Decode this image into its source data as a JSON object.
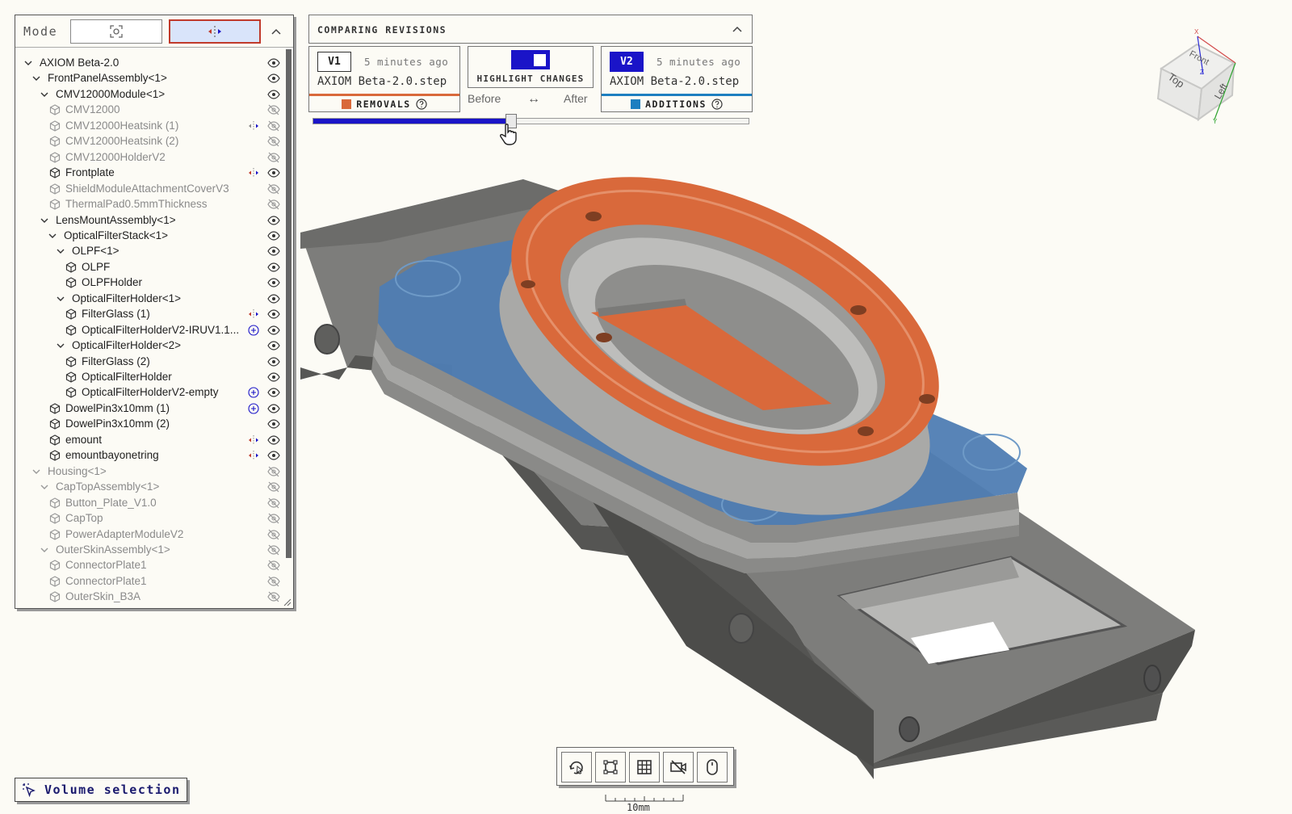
{
  "colors": {
    "accent": "#1a14c8",
    "removal": "#d9693b",
    "addition": "#1d7fc0",
    "active_border": "#c03a2b"
  },
  "mode_bar": {
    "label": "Mode",
    "buttons": [
      {
        "icon": "focus-select-icon",
        "active": false
      },
      {
        "icon": "explode-arrows-icon",
        "active": true
      }
    ],
    "collapse_icon": "chevron-up-icon"
  },
  "tree": {
    "items": [
      {
        "label": "AXIOM Beta-2.0",
        "depth": 0,
        "type": "assembly",
        "visible": true,
        "dim": false,
        "action": ""
      },
      {
        "label": "FrontPanelAssembly<1>",
        "depth": 1,
        "type": "assembly",
        "visible": true,
        "dim": false,
        "action": ""
      },
      {
        "label": "CMV12000Module<1>",
        "depth": 2,
        "type": "assembly",
        "visible": true,
        "dim": false,
        "action": ""
      },
      {
        "label": "CMV12000",
        "depth": 3,
        "type": "part",
        "visible": false,
        "dim": true,
        "action": ""
      },
      {
        "label": "CMV12000Heatsink (1)",
        "depth": 3,
        "type": "part",
        "visible": false,
        "dim": true,
        "action": "changed"
      },
      {
        "label": "CMV12000Heatsink (2)",
        "depth": 3,
        "type": "part",
        "visible": false,
        "dim": true,
        "action": ""
      },
      {
        "label": "CMV12000HolderV2",
        "depth": 3,
        "type": "part",
        "visible": false,
        "dim": true,
        "action": ""
      },
      {
        "label": "Frontplate",
        "depth": 3,
        "type": "part",
        "visible": true,
        "dim": false,
        "action": "changed-red"
      },
      {
        "label": "ShieldModuleAttachmentCoverV3",
        "depth": 3,
        "type": "part",
        "visible": false,
        "dim": true,
        "action": ""
      },
      {
        "label": "ThermalPad0.5mmThickness",
        "depth": 3,
        "type": "part",
        "visible": false,
        "dim": true,
        "action": ""
      },
      {
        "label": "LensMountAssembly<1>",
        "depth": 2,
        "type": "assembly",
        "visible": true,
        "dim": false,
        "action": ""
      },
      {
        "label": "OpticalFilterStack<1>",
        "depth": 3,
        "type": "assembly",
        "visible": true,
        "dim": false,
        "action": ""
      },
      {
        "label": "OLPF<1>",
        "depth": 4,
        "type": "assembly",
        "visible": true,
        "dim": false,
        "action": ""
      },
      {
        "label": "OLPF",
        "depth": 5,
        "type": "part",
        "visible": true,
        "dim": false,
        "action": ""
      },
      {
        "label": "OLPFHolder",
        "depth": 5,
        "type": "part",
        "visible": true,
        "dim": false,
        "action": ""
      },
      {
        "label": "OpticalFilterHolder<1>",
        "depth": 4,
        "type": "assembly",
        "visible": true,
        "dim": false,
        "action": ""
      },
      {
        "label": "FilterGlass (1)",
        "depth": 5,
        "type": "part",
        "visible": true,
        "dim": false,
        "action": "changed-red"
      },
      {
        "label": "OpticalFilterHolderV2-IRUV1.1...",
        "depth": 5,
        "type": "part",
        "visible": true,
        "dim": false,
        "action": "added"
      },
      {
        "label": "OpticalFilterHolder<2>",
        "depth": 4,
        "type": "assembly",
        "visible": true,
        "dim": false,
        "action": ""
      },
      {
        "label": "FilterGlass (2)",
        "depth": 5,
        "type": "part",
        "visible": true,
        "dim": false,
        "action": ""
      },
      {
        "label": "OpticalFilterHolder",
        "depth": 5,
        "type": "part",
        "visible": true,
        "dim": false,
        "action": ""
      },
      {
        "label": "OpticalFilterHolderV2-empty",
        "depth": 5,
        "type": "part",
        "visible": true,
        "dim": false,
        "action": "added"
      },
      {
        "label": "DowelPin3x10mm (1)",
        "depth": 3,
        "type": "part",
        "visible": true,
        "dim": false,
        "action": "added"
      },
      {
        "label": "DowelPin3x10mm (2)",
        "depth": 3,
        "type": "part",
        "visible": true,
        "dim": false,
        "action": ""
      },
      {
        "label": "emount",
        "depth": 3,
        "type": "part",
        "visible": true,
        "dim": false,
        "action": "changed-red"
      },
      {
        "label": "emountbayonetring",
        "depth": 3,
        "type": "part",
        "visible": true,
        "dim": false,
        "action": "changed-red"
      },
      {
        "label": "Housing<1>",
        "depth": 1,
        "type": "assembly",
        "visible": false,
        "dim": true,
        "action": ""
      },
      {
        "label": "CapTopAssembly<1>",
        "depth": 2,
        "type": "assembly",
        "visible": false,
        "dim": true,
        "action": ""
      },
      {
        "label": "Button_Plate_V1.0",
        "depth": 3,
        "type": "part",
        "visible": false,
        "dim": true,
        "action": ""
      },
      {
        "label": "CapTop",
        "depth": 3,
        "type": "part",
        "visible": false,
        "dim": true,
        "action": ""
      },
      {
        "label": "PowerAdapterModuleV2",
        "depth": 3,
        "type": "part",
        "visible": false,
        "dim": true,
        "action": ""
      },
      {
        "label": "OuterSkinAssembly<1>",
        "depth": 2,
        "type": "assembly",
        "visible": false,
        "dim": true,
        "action": ""
      },
      {
        "label": "ConnectorPlate1",
        "depth": 3,
        "type": "part",
        "visible": false,
        "dim": true,
        "action": ""
      },
      {
        "label": "ConnectorPlate1",
        "depth": 3,
        "type": "part",
        "visible": false,
        "dim": true,
        "action": ""
      },
      {
        "label": "OuterSkin_B3A",
        "depth": 3,
        "type": "part",
        "visible": false,
        "dim": true,
        "action": ""
      }
    ]
  },
  "compare": {
    "title": "COMPARING REVISIONS",
    "v1": {
      "badge": "V1",
      "time": "5 minutes ago",
      "file": "AXIOM Beta-2.0.step",
      "footer": "REMOVALS"
    },
    "v2": {
      "badge": "V2",
      "time": "5 minutes ago",
      "file": "AXIOM Beta-2.0.step",
      "footer": "ADDITIONS"
    },
    "highlight": {
      "label": "HIGHLIGHT CHANGES",
      "enabled": true
    },
    "before": "Before",
    "swap": "↔",
    "after": "After",
    "slider_fraction": 0.45
  },
  "view_cube": {
    "faces": [
      "Front",
      "Top",
      "Left"
    ],
    "axes": [
      "X",
      "Y",
      "Z"
    ]
  },
  "toolbar": {
    "buttons": [
      "orbit-icon",
      "fit-view-icon",
      "grid-icon",
      "camera-off-icon",
      "mouse-icon"
    ]
  },
  "scale": {
    "label": "10mm"
  },
  "volume": {
    "label": "Volume selection",
    "icon": "cursor-sparkle-icon"
  }
}
